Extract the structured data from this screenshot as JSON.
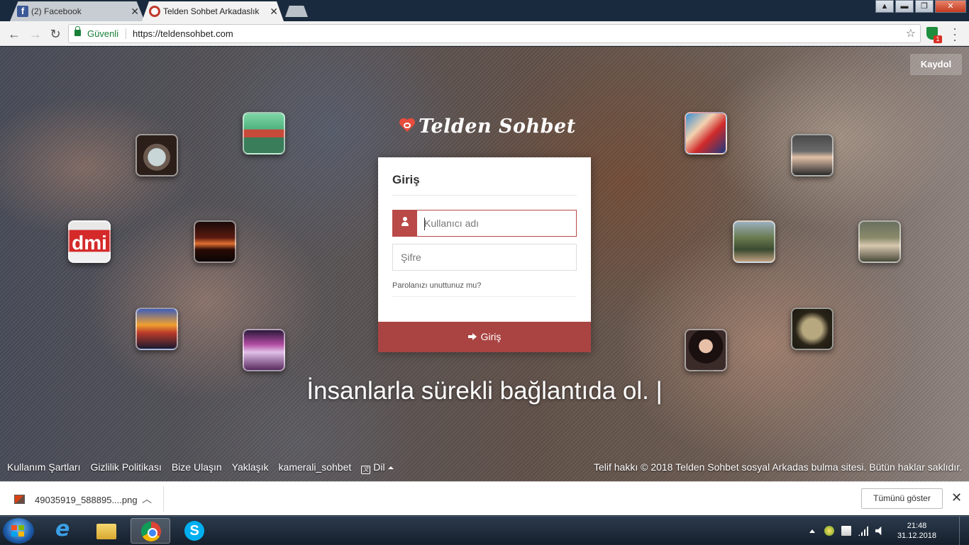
{
  "browser": {
    "tabs": [
      {
        "label": "(2) Facebook",
        "favicon": "facebook-icon"
      },
      {
        "label": "Telden Sohbet Arkadaslık",
        "favicon": "telden-sohbet-icon"
      }
    ],
    "address": {
      "secure_label": "Güvenli",
      "url": "https://teldensohbet.com"
    },
    "extension_badge": "1"
  },
  "page": {
    "register_label": "Kaydol",
    "logo_text": "Telden Sohbet",
    "login": {
      "title": "Giriş",
      "username_placeholder": "Kullanıcı adı",
      "password_placeholder": "Şifre",
      "forgot_label": "Parolanızı unuttunuz mu?",
      "submit_label": "Giriş"
    },
    "tagline": "İnsanlarla sürekli bağlantıda ol. |",
    "footer": {
      "links": [
        "Kullanım Şartları",
        "Gizlilik Politikası",
        "Bize Ulaşın",
        "Yaklaşık",
        "kamerali_sohbet"
      ],
      "language_label": "Dil",
      "copyright": "Telif hakkı © 2018 Telden Sohbet sosyal Arkadas bulma sitesi. Bütün haklar saklıdır."
    },
    "avatar_badge_text": "dmi"
  },
  "download_bar": {
    "file_name": "49035919_588895....png",
    "show_all_label": "Tümünü göster"
  },
  "taskbar": {
    "time": "21:48",
    "date": "31.12.2018"
  },
  "colors": {
    "brand_red": "#a94442",
    "input_error": "#b94a48",
    "secure_green": "#188038"
  }
}
